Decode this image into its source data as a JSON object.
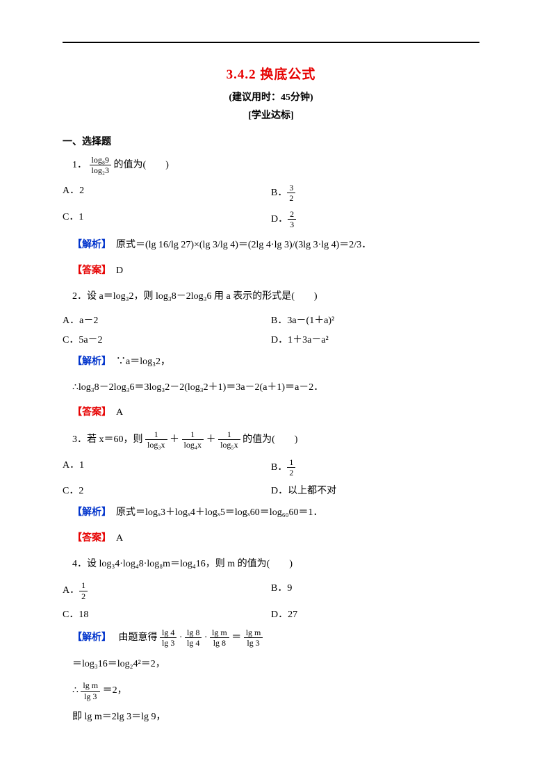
{
  "title_main": "3.4.2 换底公式",
  "time_hint": "(建议用时：45分钟)",
  "standard_tag": "[学业达标]",
  "section1": "一、选择题",
  "q1": {
    "num": "1．",
    "frac_num": "log₈9",
    "frac_den": "log₂3",
    "tail": "的值为(　　)",
    "A": "A．2",
    "B_pre": "B．",
    "B_num": "3",
    "B_den": "2",
    "C": "C．1",
    "D_pre": "D．",
    "D_num": "2",
    "D_den": "3",
    "ana_tag": "【解析】",
    "ana_body": "原式＝(lg 16/lg 27)×(lg 3/lg 4)＝(2lg 4·lg 3)/(3lg 3·lg 4)＝2/3．",
    "ans_tag": "【答案】",
    "ans": "D"
  },
  "q2": {
    "stem": "2．设 a＝log₃2，则 log₃8－2log₃6 用 a 表示的形式是(　　)",
    "A": "A．a－2",
    "B": "B．3a－(1＋a)²",
    "C": "C．5a－2",
    "D": "D．1＋3a－a²",
    "ana_tag": "【解析】",
    "ana1": "∵a＝log₃2，",
    "ana2": "∴log₃8－2log₃6＝3log₃2－2(log₃2＋1)＝3a－2(a＋1)＝a－2．",
    "ans_tag": "【答案】",
    "ans": "A"
  },
  "q3": {
    "stem_pre": "3．若 x＝60，则 ",
    "f1n": "1",
    "f1d": "log₃x",
    "plus1": "＋",
    "f2n": "1",
    "f2d": "log₄x",
    "plus2": "＋",
    "f3n": "1",
    "f3d": "log₅x",
    "stem_post": " 的值为(　　)",
    "A": "A．1",
    "B_pre": "B．",
    "B_num": "1",
    "B_den": "2",
    "C": "C．2",
    "D": "D．以上都不对",
    "ana_tag": "【解析】",
    "ana": "原式＝logₓ3＋logₓ4＋logₓ5＝logₓ60＝log₆₀60＝1．",
    "ans_tag": "【答案】",
    "ans": "A"
  },
  "q4": {
    "stem": "4．设 log₃4·log₄8·log₈m＝log₄16，则 m 的值为(　　)",
    "A_pre": "A．",
    "A_num": "1",
    "A_den": "2",
    "B": "B．9",
    "C": "C．18",
    "D": "D．27",
    "ana_tag": "【解析】",
    "ana_pre": "由题意得 ",
    "t1n": "lg 4",
    "t1d": "lg 3",
    "dot1": "·",
    "t2n": "lg 8",
    "t2d": "lg 4",
    "dot2": "·",
    "t3n": "lg m",
    "t3d": "lg 8",
    "eq": "＝",
    "t4n": "lg m",
    "t4d": "lg 3",
    "line2": "＝log₃16＝log₂4²＝2，",
    "line3_pre": "∴",
    "l3n": "lg m",
    "l3d": "lg 3",
    "line3_post": "＝2，",
    "line4": "即 lg m＝2lg 3＝lg 9，"
  }
}
